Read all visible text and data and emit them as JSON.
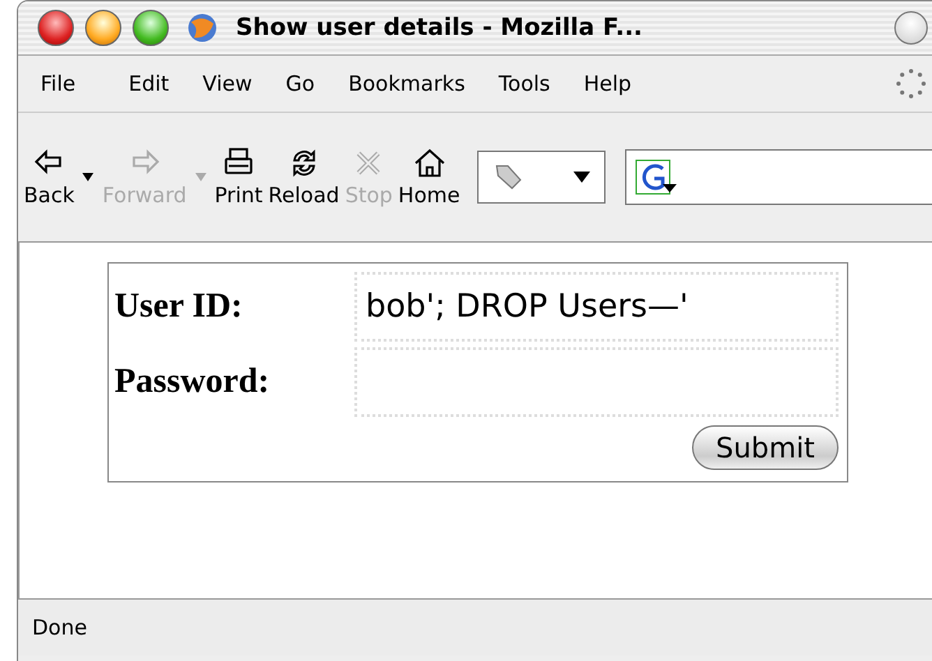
{
  "window": {
    "title": "Show user details - Mozilla F..."
  },
  "menu": [
    "File",
    "Edit",
    "View",
    "Go",
    "Bookmarks",
    "Tools",
    "Help"
  ],
  "toolbar": [
    {
      "kind": "back",
      "label": "Back",
      "disabled": false
    },
    {
      "kind": "forward",
      "label": "Forward",
      "disabled": true
    },
    {
      "kind": "print",
      "label": "Print",
      "disabled": false
    },
    {
      "kind": "reload",
      "label": "Reload",
      "disabled": false
    },
    {
      "kind": "stop",
      "label": "Stop",
      "disabled": true
    },
    {
      "kind": "home",
      "label": "Home",
      "disabled": false
    }
  ],
  "form": {
    "fields": [
      {
        "label": "User ID:",
        "value": "bob'; DROP Users—'"
      },
      {
        "label": "Password:"
      }
    ],
    "submit": "Submit"
  },
  "status_bar": "Done"
}
